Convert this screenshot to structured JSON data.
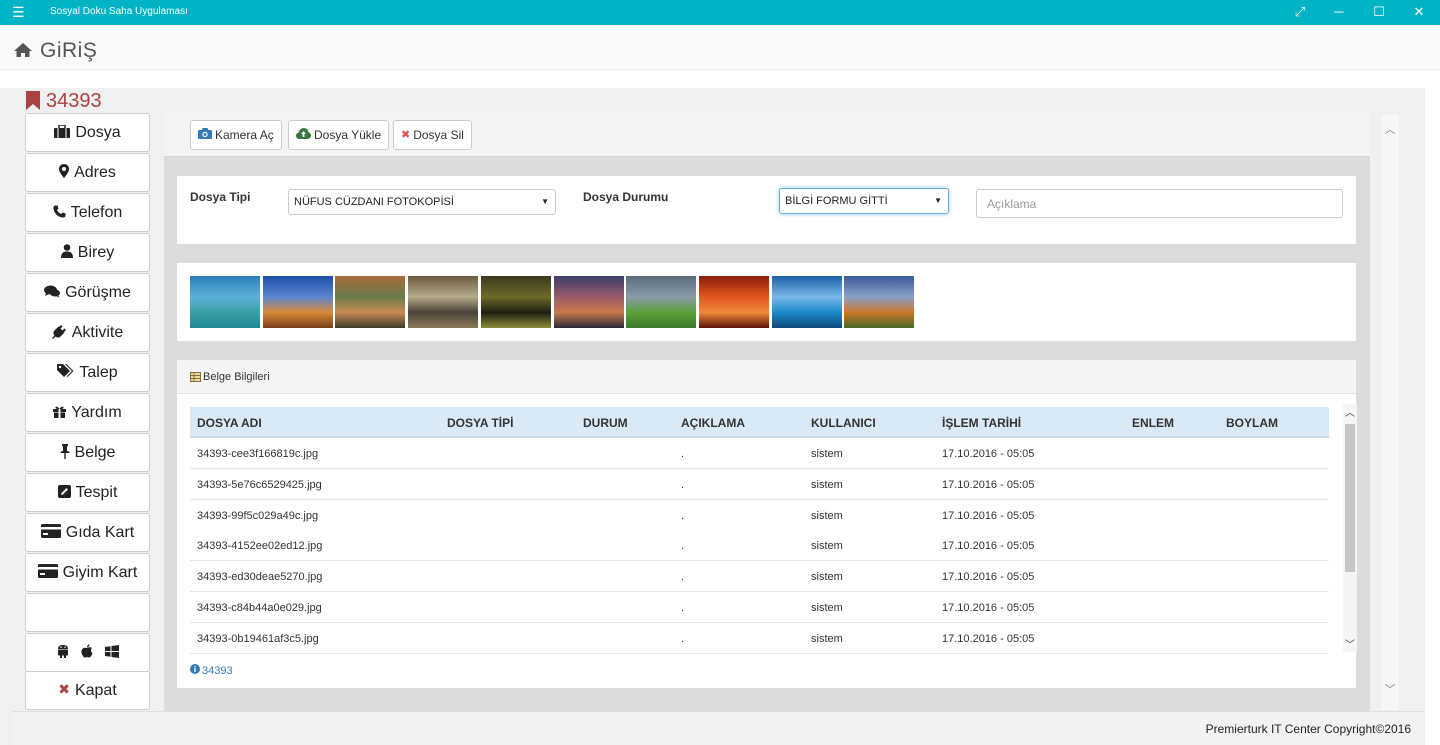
{
  "window": {
    "title": "Sosyal Doku Saha Uygulaması",
    "menu_icon": "hamburger-icon",
    "controls": [
      "expand-icon",
      "minimize-icon",
      "maximize-icon",
      "close-icon"
    ]
  },
  "header": {
    "icon": "home-icon",
    "title": "GiRiŞ"
  },
  "record": {
    "icon": "bookmark-icon",
    "id": "34393"
  },
  "sidebar": {
    "items": [
      {
        "label": "Dosya",
        "icon": "briefcase-icon"
      },
      {
        "label": "Adres",
        "icon": "map-marker-icon"
      },
      {
        "label": "Telefon",
        "icon": "phone-icon"
      },
      {
        "label": "Birey",
        "icon": "user-icon"
      },
      {
        "label": "Görüşme",
        "icon": "comments-icon"
      },
      {
        "label": "Aktivite",
        "icon": "plug-icon"
      },
      {
        "label": "Talep",
        "icon": "tags-icon"
      },
      {
        "label": "Yardım",
        "icon": "gift-icon"
      },
      {
        "label": "Belge",
        "icon": "pushpin-icon"
      },
      {
        "label": "Tespit",
        "icon": "edit-icon"
      },
      {
        "label": "Gıda Kart",
        "icon": "credit-card-icon"
      },
      {
        "label": "Giyim Kart",
        "icon": "credit-card-icon"
      },
      {
        "label": "",
        "icon": ""
      }
    ],
    "platform_icons": [
      "android-icon",
      "apple-icon",
      "windows-icon"
    ],
    "close_label": "Kapat"
  },
  "toolbar": {
    "camera_label": "Kamera Aç",
    "upload_label": "Dosya Yükle",
    "delete_label": "Dosya Sil"
  },
  "filters": {
    "type_label": "Dosya Tipi",
    "type_value": "NÜFUS CÜZDANI FOTOKOPİSİ",
    "status_label": "Dosya Durumu",
    "status_value": "BİLGİ FORMU GİTTİ",
    "description_placeholder": "Açıklama"
  },
  "gallery": {
    "thumbnails": [
      {
        "name": "island-boat-thumbnail",
        "colors": [
          "#2a7fb8",
          "#5fb0d8",
          "#3aa0a8",
          "#1e8a95"
        ]
      },
      {
        "name": "desert-sky-thumbnail",
        "colors": [
          "#1f4fa8",
          "#5a86d0",
          "#d98a3a",
          "#7a3e1c"
        ]
      },
      {
        "name": "canyon-bend-thumbnail",
        "colors": [
          "#a86b3c",
          "#6b7b4a",
          "#c98a54",
          "#3d3b2a"
        ]
      },
      {
        "name": "waterfall-cliff-thumbnail",
        "colors": [
          "#6b5a3f",
          "#b7ab8c",
          "#4a4336",
          "#8a7a5c"
        ]
      },
      {
        "name": "caterpillar-thumbnail",
        "colors": [
          "#3a3a1e",
          "#6e6a2a",
          "#1f1f12",
          "#8a8a3a"
        ]
      },
      {
        "name": "bridge-sunset-thumbnail",
        "colors": [
          "#3a3f6a",
          "#9a5a6a",
          "#c87a4a",
          "#2a2a3a"
        ]
      },
      {
        "name": "green-hills-thumbnail",
        "colors": [
          "#5a6b7a",
          "#8a9aa8",
          "#5aa03a",
          "#3a7a2a"
        ]
      },
      {
        "name": "red-tunnel-thumbnail",
        "colors": [
          "#8a1e0e",
          "#e2551e",
          "#f08a3a",
          "#5a1208"
        ]
      },
      {
        "name": "sea-boat-thumbnail",
        "colors": [
          "#1e5fa8",
          "#7ab8e8",
          "#1a8ac8",
          "#0e4a7a"
        ]
      },
      {
        "name": "autumn-tree-thumbnail",
        "colors": [
          "#3a5a9a",
          "#8aa0c8",
          "#c8782a",
          "#4a6a2a"
        ]
      }
    ]
  },
  "documents": {
    "panel_title": "Belge Bilgileri",
    "panel_icon": "table-icon",
    "columns": [
      "DOSYA ADI",
      "DOSYA TİPİ",
      "DURUM",
      "AÇIKLAMA",
      "KULLANICI",
      "İŞLEM TARİHİ",
      "ENLEM",
      "BOYLAM"
    ],
    "rows": [
      {
        "file": "34393-cee3f166819c.jpg",
        "type": "",
        "status": "",
        "desc": ".",
        "user": "sistem",
        "date": "17.10.2016 - 05:05",
        "lat": "",
        "lon": ""
      },
      {
        "file": "34393-5e76c6529425.jpg",
        "type": "",
        "status": "",
        "desc": ".",
        "user": "sistem",
        "date": "17.10.2016 - 05:05",
        "lat": "",
        "lon": ""
      },
      {
        "file": "34393-99f5c029a49c.jpg",
        "type": "",
        "status": "",
        "desc": ".",
        "user": "sistem",
        "date": "17.10.2016 - 05:05",
        "lat": "",
        "lon": ""
      },
      {
        "file": "34393-4152ee02ed12.jpg",
        "type": "",
        "status": "",
        "desc": ".",
        "user": "sistem",
        "date": "17.10.2016 - 05:05",
        "lat": "",
        "lon": ""
      },
      {
        "file": "34393-ed30deae5270.jpg",
        "type": "",
        "status": "",
        "desc": ".",
        "user": "sistem",
        "date": "17.10.2016 - 05:05",
        "lat": "",
        "lon": ""
      },
      {
        "file": "34393-c84b44a0e029.jpg",
        "type": "",
        "status": "",
        "desc": ".",
        "user": "sistem",
        "date": "17.10.2016 - 05:05",
        "lat": "",
        "lon": ""
      },
      {
        "file": "34393-0b19461af3c5.jpg",
        "type": "",
        "status": "",
        "desc": ".",
        "user": "sistem",
        "date": "17.10.2016 - 05:05",
        "lat": "",
        "lon": ""
      }
    ],
    "footer_id": "34393",
    "footer_icon": "info-circle-icon"
  },
  "status": {
    "copyright": "Premierturk IT Center Copyright©2016"
  },
  "colors": {
    "titlebar": "#00b4c5",
    "accent_red": "#a94442",
    "table_header": "#d9eaf6",
    "link": "#337ab7"
  }
}
